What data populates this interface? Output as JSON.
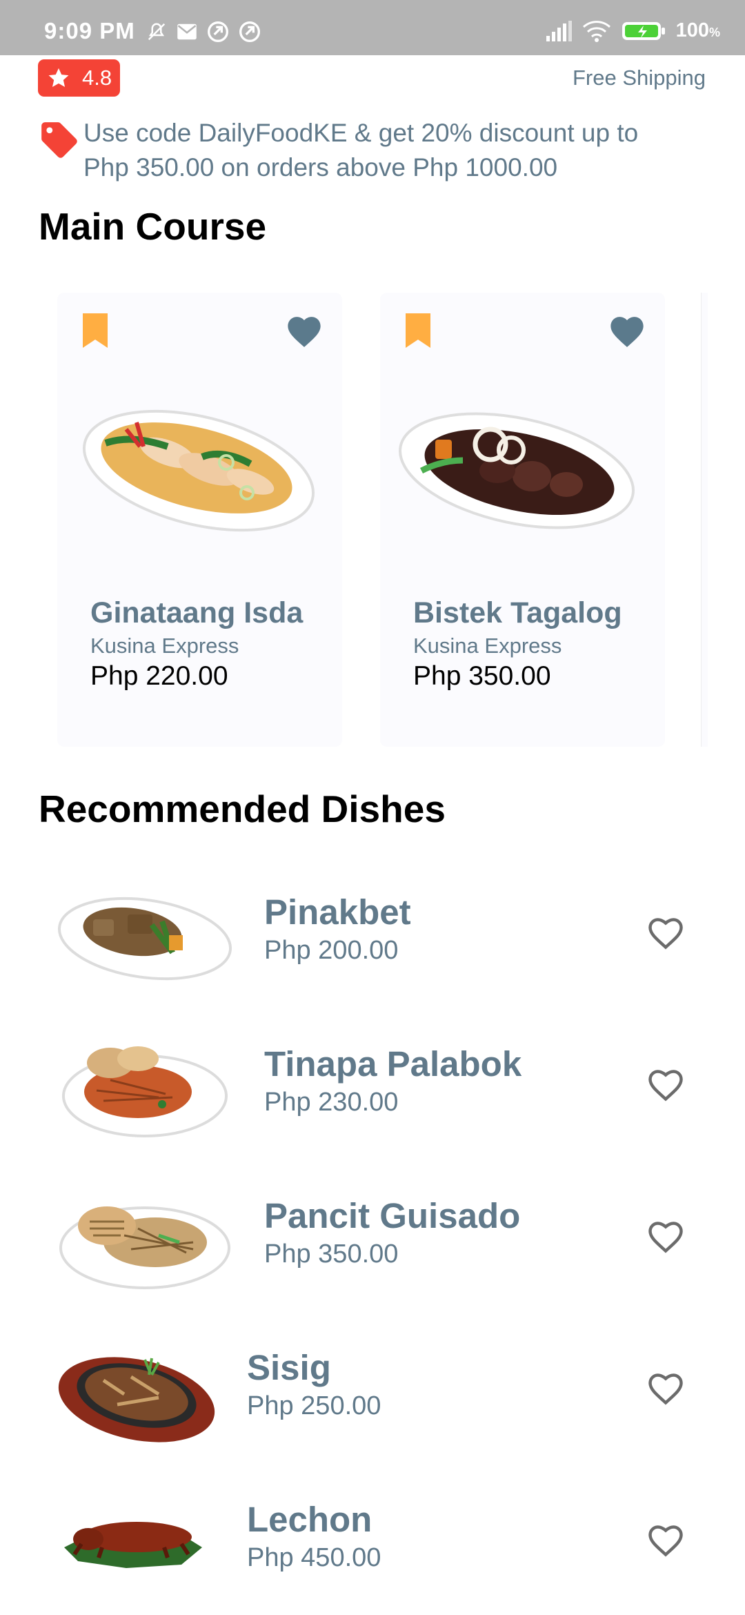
{
  "status_bar": {
    "time": "9:09 PM",
    "battery": "100",
    "battery_unit": "%"
  },
  "header": {
    "rating": "4.8",
    "shipping": "Free Shipping"
  },
  "promo": {
    "text": "Use code DailyFoodKE & get 20% discount up to Php 350.00 on orders above Php 1000.00"
  },
  "main_course": {
    "title": "Main Course",
    "items": [
      {
        "name": "Ginataang Isda",
        "vendor": "Kusina Express",
        "price": "Php 220.00"
      },
      {
        "name": "Bistek Tagalog",
        "vendor": "Kusina Express",
        "price": "Php 350.00"
      }
    ]
  },
  "recommended": {
    "title": "Recommended Dishes",
    "items": [
      {
        "name": "Pinakbet",
        "price": "Php 200.00"
      },
      {
        "name": "Tinapa Palabok",
        "price": "Php 230.00"
      },
      {
        "name": "Pancit Guisado",
        "price": "Php 350.00"
      },
      {
        "name": "Sisig",
        "price": "Php 250.00"
      },
      {
        "name": "Lechon",
        "price": "Php 450.00"
      }
    ]
  },
  "colors": {
    "accent_text": "#60798a",
    "badge_red": "#f44336",
    "bookmark": "#ffae42",
    "heart_fill": "#5b7a8c"
  },
  "icons": [
    "bell-off-icon",
    "mail-icon",
    "sync-icon",
    "signal-icon",
    "wifi-icon",
    "battery-icon",
    "star-icon",
    "tag-icon",
    "bookmark-icon",
    "heart-icon",
    "heart-outline-icon"
  ]
}
